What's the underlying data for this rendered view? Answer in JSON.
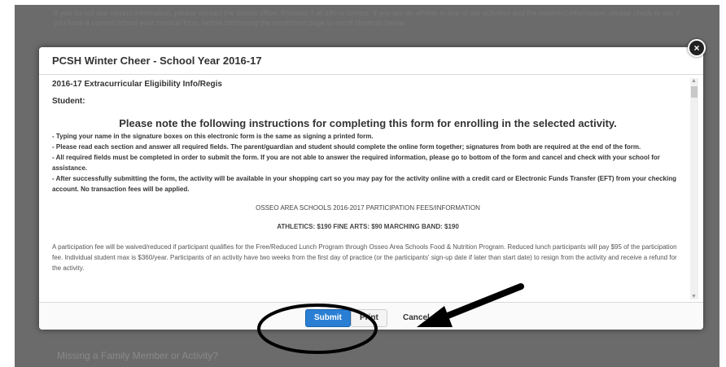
{
  "background": {
    "top_text": "If you do not see correct information, please contact the district office. Proceed if all info is correct. If you are an athlete in one of our activities and the incorrect information, please check to see if you have a current school year medical form, before continuing the enrollment page to enroll students below.",
    "bottom_link": "Missing a Family Member or Activity?"
  },
  "modal": {
    "title": "PCSH Winter Cheer - School Year 2016-17",
    "close_label": "×",
    "section_heading": "2016-17 Extracurricular Eligibility Info/Regis",
    "student_label": "Student:",
    "instructions_heading": "Please note the following instructions for completing this form for enrolling in the selected activity.",
    "bullets": [
      "- Typing your name in the signature boxes on this electronic form is the same as signing a printed form.",
      "- Please read each section and answer all required fields.  The parent/guardian and student should complete the online form together; signatures from both are required at the end of the form.",
      "- All required fields must be completed in order to submit the form.  If you are not able to answer the required information, please go to bottom of the form and cancel and check with your school for assistance.",
      "- After successfully submitting the form, the activity will be available in your shopping cart so you may pay for the activity online with a credit card or Electronic Funds Transfer (EFT) from your checking account.  No transaction fees will be applied."
    ],
    "fees_title": "OSSEO AREA SCHOOLS 2016-2017 PARTICIPATION FEES/INFORMATION",
    "fees_line": "ATHLETICS: $190    FINE ARTS: $90    MARCHING BAND:  $190",
    "fee_paragraph": "A participation fee will be waived/reduced if participant qualifies for the Free/Reduced Lunch Program through Osseo Area Schools Food & Nutrition Program. Reduced lunch participants will pay $95 of the participation fee. Individual student max is $360/year.  Participants of an activity have two weeks from the first day of practice (or the participants' sign-up date if later than start date) to resign from the activity and receive a refund for the activity.",
    "footer": {
      "submit_label": "Submit",
      "print_label": "Print",
      "cancel_label": "Cancel"
    }
  },
  "colors": {
    "submit_blue": "#2a7fd4",
    "overlay_gray": "#6b6b6b",
    "annotation_black": "#000000"
  }
}
